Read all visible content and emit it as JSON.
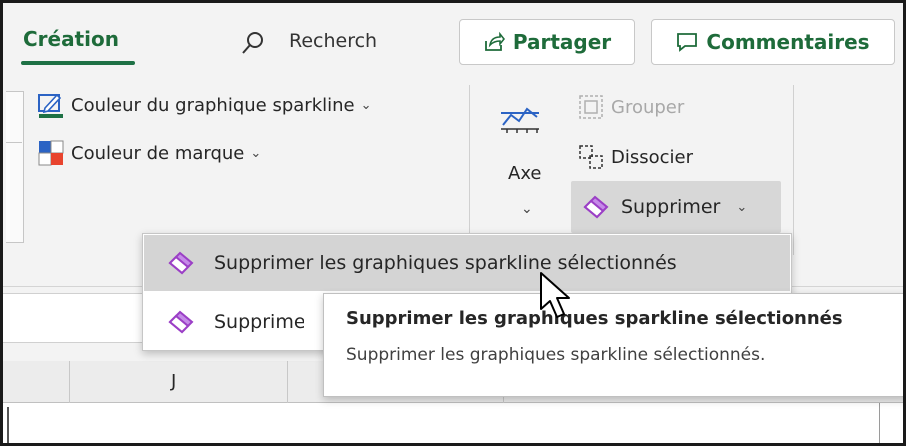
{
  "tabs": {
    "active": "Création",
    "search": "Recherch"
  },
  "actions": {
    "share_label": "Partager",
    "comments_label": "Commentaires"
  },
  "ribbon": {
    "sparkline_color": "Couleur du graphique sparkline",
    "marker_color": "Couleur de marque",
    "axe": "Axe",
    "group": "Grouper",
    "ungroup": "Dissocier",
    "delete": "Supprimer"
  },
  "menu": {
    "items": [
      {
        "label": "Supprimer les graphiques sparkline sélectionnés"
      },
      {
        "label": "Supprimer"
      }
    ]
  },
  "tooltip": {
    "title": "Supprimer les graphiques sparkline sélectionnés",
    "description": "Supprimer les graphiques sparkline sélectionnés."
  },
  "grid": {
    "column_label": "J"
  },
  "colors": {
    "accent": "#1e7145",
    "eraser": "#9b3fc6"
  }
}
